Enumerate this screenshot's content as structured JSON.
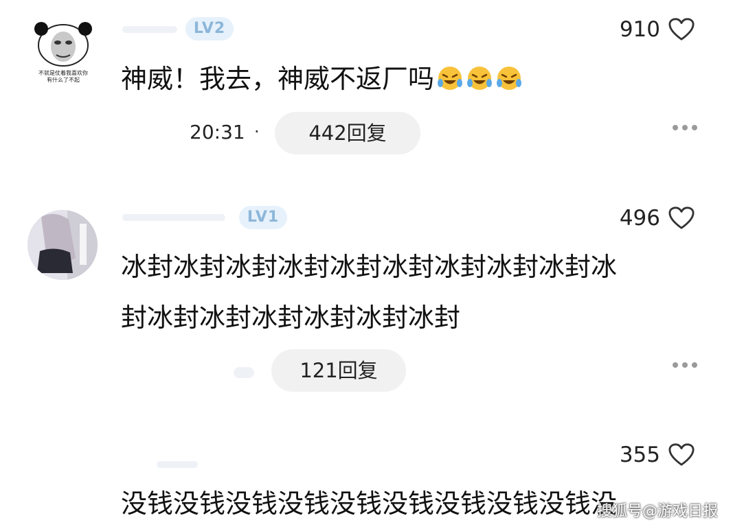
{
  "comments": [
    {
      "level": "LV2",
      "likes": "910",
      "text": "神威！我去，神威不返厂吗",
      "emoji_count": 3,
      "time": "20:31",
      "time_separator": "·",
      "replies": "442回复",
      "avatar_caption_line1": "不就是仗着我喜欢你",
      "avatar_caption_line2": "有什么了不起"
    },
    {
      "level": "LV1",
      "likes": "496",
      "text_line1": "冰封冰封冰封冰封冰封冰封冰封冰封冰封冰",
      "text_line2": "封冰封冰封冰封冰封冰封冰封",
      "replies": "121回复"
    },
    {
      "likes": "355",
      "text": "没钱没钱没钱没钱没钱没钱没钱没钱没钱没"
    }
  ],
  "watermark": "搜狐号@游戏日报",
  "colors": {
    "badge_bg": "#e6f1fb",
    "badge_text": "#8cb6d9",
    "pill_bg": "#f1f1f1"
  },
  "icons": [
    "heart-outline-icon",
    "more-dots-icon",
    "crying-laugh-emoji"
  ]
}
